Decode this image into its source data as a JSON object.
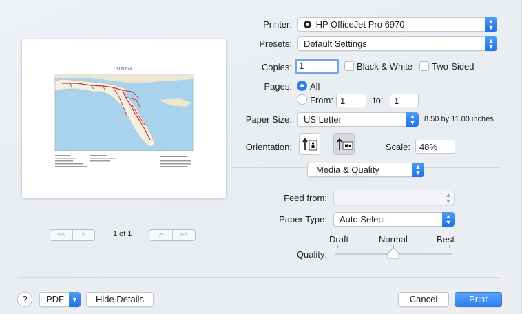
{
  "printer": {
    "label": "Printer:",
    "value": "HP OfficeJet Pro 6970"
  },
  "presets": {
    "label": "Presets:",
    "value": "Default Settings"
  },
  "copies": {
    "label": "Copies:",
    "value": "1",
    "bw_label": "Black & White",
    "two_sided_label": "Two-Sided"
  },
  "pages": {
    "label": "Pages:",
    "all_label": "All",
    "from_label": "From:",
    "from_value": "1",
    "to_label": "to:",
    "to_value": "1"
  },
  "paper_size": {
    "label": "Paper Size:",
    "value": "US Letter",
    "dimensions": "8.50 by 11.00 inches"
  },
  "orientation": {
    "label": "Orientation:"
  },
  "scale": {
    "label": "Scale:",
    "value": "48%"
  },
  "section": {
    "value": "Media & Quality"
  },
  "feed_from": {
    "label": "Feed from:",
    "value": ""
  },
  "paper_type": {
    "label": "Paper Type:",
    "value": "Auto Select"
  },
  "quality": {
    "label": "Quality:",
    "draft": "Draft",
    "normal": "Normal",
    "best": "Best",
    "level": 0.5
  },
  "preview": {
    "map_title": "SUN Trail",
    "page_indicator": "1 of 1",
    "first_prev": [
      "<<",
      "<"
    ],
    "next_last": [
      ">",
      ">>"
    ]
  },
  "footer": {
    "help": "?",
    "pdf": "PDF",
    "hide_details": "Hide Details",
    "cancel": "Cancel",
    "print": "Print"
  },
  "colors": {
    "accent": "#2a7ef0",
    "trail": "#cc2b2b",
    "land": "#f3efe2",
    "water": "#a9d3ec"
  }
}
